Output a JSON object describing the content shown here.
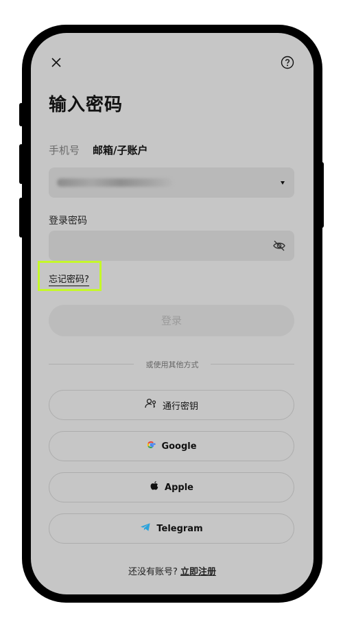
{
  "header": {
    "close_icon": "close-icon",
    "help_icon": "help-icon"
  },
  "title": "输入密码",
  "tabs": [
    {
      "label": "手机号",
      "active": false
    },
    {
      "label": "邮箱/子账户",
      "active": true
    }
  ],
  "account_field": {
    "value_obscured": true,
    "dropdown_icon": "caret-down-icon"
  },
  "password": {
    "label": "登录密码",
    "value": "",
    "visibility_icon": "eye-slash-icon"
  },
  "forgot_password": "忘记密码?",
  "login_button": "登录",
  "divider_text": "或使用其他方式",
  "alt_logins": [
    {
      "label": "通行密钥",
      "icon": "passkey-icon"
    },
    {
      "label": "Google",
      "icon": "google-icon"
    },
    {
      "label": "Apple",
      "icon": "apple-icon"
    },
    {
      "label": "Telegram",
      "icon": "telegram-icon"
    }
  ],
  "footer": {
    "prompt": "还没有账号?",
    "register_link": "立即注册"
  },
  "colors": {
    "highlight": "#c5f82a",
    "telegram": "#2aa3dc"
  }
}
